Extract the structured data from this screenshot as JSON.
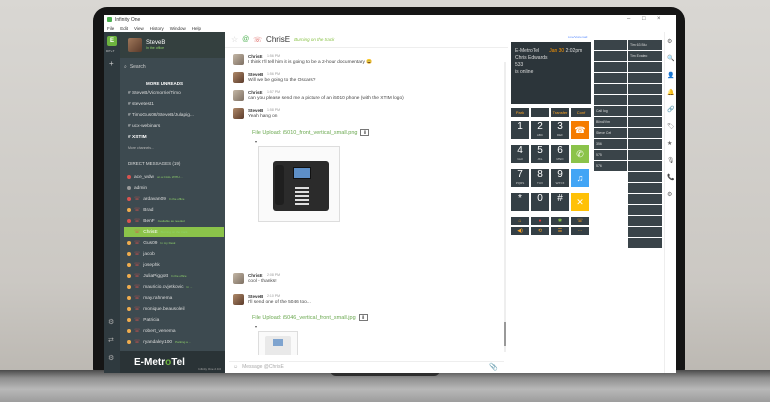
{
  "window": {
    "title": "Infinity One",
    "controls": {
      "minimize": "–",
      "maximize": "□",
      "close": "×"
    }
  },
  "menu": [
    "File",
    "Edit",
    "View",
    "History",
    "Window",
    "Help"
  ],
  "rail": {
    "logo": "E",
    "label": "DIT+T",
    "add": "+",
    "bottom_icons": [
      "⚙",
      "⇄",
      "⚙"
    ]
  },
  "user": {
    "name": "SteveB",
    "status": "In the office"
  },
  "search": {
    "placeholder": "Search"
  },
  "channels": {
    "title": "MORE UNREADS",
    "items": [
      "SteveB/Vicmorrie/Timo",
      "stevetest1",
      "TimoGus08/SteveB/Julapig...",
      "ucx-webinars",
      "XSTIM",
      "More channels..."
    ]
  },
  "dms": {
    "title": "DIRECT MESSAGES (19)",
    "items": [
      {
        "name": "ace_wdw",
        "status": "on a CALL WITH ...",
        "color": "#d9534f",
        "phone": false
      },
      {
        "name": "admin",
        "status": "",
        "color": "#999999",
        "phone": false
      },
      {
        "name": "ardavan09",
        "status": "In the office",
        "color": "#d9534f",
        "phone": true
      },
      {
        "name": "Brad",
        "status": "",
        "color": "#f0ad4e",
        "phone": true
      },
      {
        "name": "BenF",
        "status": "Available as needed",
        "color": "#d9534f",
        "phone": true
      },
      {
        "name": "ChrisE",
        "status": "Burning on the track",
        "color": "#8bc34a",
        "phone": true,
        "active": true
      },
      {
        "name": "Gus09",
        "status": "In my Desk",
        "color": "#f0ad4e",
        "phone": true
      },
      {
        "name": "jacob",
        "status": "",
        "color": "#f0ad4e",
        "phone": true
      },
      {
        "name": "josephk",
        "status": "",
        "color": "#f0ad4e",
        "phone": true
      },
      {
        "name": "JuliaPiggott",
        "status": "In the office",
        "color": "#f0ad4e",
        "phone": true
      },
      {
        "name": "mauricio.cvjetkovic",
        "status": "In ...",
        "color": "#f0ad4e",
        "phone": true
      },
      {
        "name": "may.rahnema",
        "status": "",
        "color": "#f0ad4e",
        "phone": true
      },
      {
        "name": "monique.beausoleil",
        "status": "",
        "color": "#f0ad4e",
        "phone": true
      },
      {
        "name": "Patricia",
        "status": "",
        "color": "#f0ad4e",
        "phone": true
      },
      {
        "name": "robert_venema",
        "status": "",
        "color": "#f0ad4e",
        "phone": true
      },
      {
        "name": "ryandaley100",
        "status": "Parking a ...",
        "color": "#f0ad4e",
        "phone": true
      }
    ]
  },
  "brand": {
    "name_a": "E-Metr",
    "name_o": "o",
    "name_b": "Tel",
    "sub": "Infinity One 2.0.0"
  },
  "chat": {
    "name": "ChrisE",
    "status": "Burning on the track",
    "messages": [
      {
        "author": "ChrisE",
        "time": "1:56 PM",
        "text": "I think I'll tell him it is going to be a 2-hour documentary 😄",
        "self": false
      },
      {
        "author": "SteveB",
        "time": "1:56 PM",
        "text": "Will we be going to the Oscars?",
        "self": true
      },
      {
        "author": "ChrisE",
        "time": "1:57 PM",
        "text": "can you please send me a picture of an i5010 phone (with the XTIM logo)",
        "self": false
      },
      {
        "author": "SteveB",
        "time": "1:58 PM",
        "text": "Yeah hang on",
        "self": true
      },
      {
        "author": "ChrisE",
        "time": "2:08 PM",
        "text": "cool - thanks!",
        "self": false
      },
      {
        "author": "SteveB",
        "time": "2:10 PM",
        "text": "I'll send one of the 5046 too...",
        "self": true
      }
    ],
    "uploads": [
      {
        "label": "File Upload: i5010_front_vertical_small.png",
        "download": "⬇"
      },
      {
        "label": "File Upload: i5046_vertical_front_small.jpg",
        "download": "⬇"
      }
    ],
    "compose_placeholder": "Message @ChrisE",
    "attach_icon": "📎"
  },
  "softphone": {
    "indicator": "Line/Voicemail",
    "lcd": [
      "E-MetroTel",
      "Chris Edwards",
      "533",
      "is online"
    ],
    "date": "Jan 30",
    "time": "2:02pm",
    "softkeys": [
      "Park",
      "",
      "Transfer",
      "Conf"
    ],
    "keys": [
      {
        "n": "1",
        "l": ""
      },
      {
        "n": "2",
        "l": "ABC"
      },
      {
        "n": "3",
        "l": "DEF"
      },
      {
        "n": "4",
        "l": "GHI"
      },
      {
        "n": "5",
        "l": "JKL"
      },
      {
        "n": "6",
        "l": "MNO"
      },
      {
        "n": "7",
        "l": "PQRS"
      },
      {
        "n": "8",
        "l": "TUV"
      },
      {
        "n": "9",
        "l": "WXYZ"
      },
      {
        "n": "*",
        "l": ""
      },
      {
        "n": "0",
        "l": ""
      },
      {
        "n": "#",
        "l": ""
      }
    ],
    "blf_left": [
      "",
      "",
      "",
      "",
      "",
      "",
      "Call log",
      "Blind/Vm",
      "Steve Cel",
      "356",
      "575",
      "576"
    ],
    "blf_right": [
      {
        "label": "Tim 63 Blu",
        "value": ""
      },
      {
        "label": "Tim Evaleo",
        "value": ""
      },
      {
        "label": "",
        "value": ""
      },
      {
        "label": "",
        "value": ""
      },
      {
        "label": "",
        "value": ""
      },
      {
        "label": "",
        "value": ""
      },
      {
        "label": "",
        "value": ""
      },
      {
        "label": "",
        "value": ""
      },
      {
        "label": "",
        "value": ""
      },
      {
        "label": "",
        "value": ""
      },
      {
        "label": "",
        "value": ""
      },
      {
        "label": "",
        "value": ""
      },
      {
        "label": "",
        "value": ""
      },
      {
        "label": "",
        "value": ""
      },
      {
        "label": "",
        "value": ""
      },
      {
        "label": "",
        "value": ""
      },
      {
        "label": "",
        "value": ""
      },
      {
        "label": "",
        "value": ""
      },
      {
        "label": "",
        "value": ""
      }
    ]
  },
  "tools": [
    "⚙",
    "🔍",
    "👤",
    "🔔",
    "🔗",
    "🏷",
    "★",
    "🎙",
    "📞",
    "⚙"
  ]
}
